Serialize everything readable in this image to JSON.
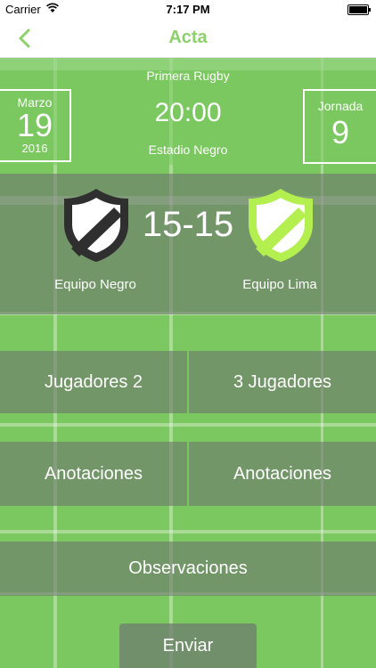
{
  "status_bar": {
    "carrier": "Carrier",
    "time": "7:17 PM"
  },
  "nav": {
    "title": "Acta"
  },
  "match": {
    "competition": "Primera Rugby",
    "date": {
      "month": "Marzo",
      "day": "19",
      "year": "2016"
    },
    "time": "20:00",
    "stadium": "Estadio Negro",
    "round": {
      "label": "Jornada",
      "number": "9"
    },
    "score": "15-15",
    "home_team": {
      "name": "Equipo Negro",
      "color": "#2f2f2f"
    },
    "away_team": {
      "name": "Equipo Lima",
      "color": "#b2ef4f"
    }
  },
  "actions": {
    "home_players": "Jugadores   2",
    "away_players": "3   Jugadores",
    "home_notes": "Anotaciones",
    "away_notes": "Anotaciones",
    "observations": "Observaciones",
    "send": "Enviar"
  },
  "colors": {
    "accent": "#8cd16a",
    "field": "#7cc860",
    "panel": "#6e786e"
  },
  "icons": {
    "back": "chevron-left-icon",
    "wifi": "wifi-icon",
    "battery": "battery-icon",
    "shield": "shield-icon"
  }
}
